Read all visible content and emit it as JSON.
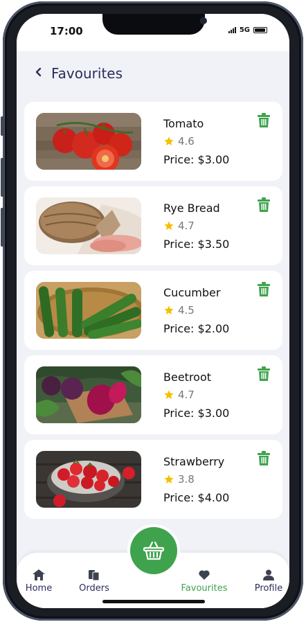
{
  "status_bar": {
    "time": "17:00",
    "network": "5G"
  },
  "header": {
    "title": "Favourites"
  },
  "favourites": [
    {
      "name": "Tomato",
      "rating": "4.6",
      "price": "Price: $3.00",
      "image": "tomato-photo"
    },
    {
      "name": "Rye Bread",
      "rating": "4.7",
      "price": "Price: $3.50",
      "image": "rye-bread-photo"
    },
    {
      "name": "Cucumber",
      "rating": "4.5",
      "price": "Price: $2.00",
      "image": "cucumber-photo"
    },
    {
      "name": "Beetroot",
      "rating": "4.7",
      "price": "Price: $3.00",
      "image": "beetroot-photo"
    },
    {
      "name": "Strawberry",
      "rating": "3.8",
      "price": "Price: $4.00",
      "image": "strawberry-photo"
    }
  ],
  "bottom_nav": {
    "items": [
      {
        "label": "Home",
        "icon": "home-icon",
        "active": false
      },
      {
        "label": "Orders",
        "icon": "orders-icon",
        "active": false
      },
      {
        "label": "Favourites",
        "icon": "heart-icon",
        "active": true
      },
      {
        "label": "Profile",
        "icon": "profile-icon",
        "active": false
      }
    ],
    "fab_icon": "basket-icon"
  },
  "colors": {
    "accent": "#3fa34d",
    "title": "#2b2d5c",
    "star": "#f4c000",
    "background": "#f0f2f7"
  }
}
